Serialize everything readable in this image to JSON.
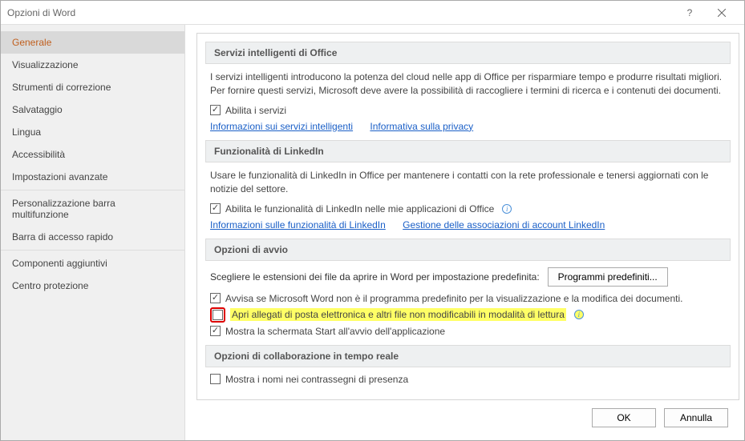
{
  "window": {
    "title": "Opzioni di Word"
  },
  "sidebar": {
    "items": [
      "Generale",
      "Visualizzazione",
      "Strumenti di correzione",
      "Salvataggio",
      "Lingua",
      "Accessibilità",
      "Impostazioni avanzate",
      "Personalizzazione barra multifunzione",
      "Barra di accesso rapido",
      "Componenti aggiuntivi",
      "Centro protezione"
    ]
  },
  "sections": {
    "smart": {
      "title": "Servizi intelligenti di Office",
      "desc": "I servizi intelligenti introducono la potenza del cloud nelle app di Office per risparmiare tempo e produrre risultati migliori. Per fornire questi servizi, Microsoft deve avere la possibilità di raccogliere i termini di ricerca e i contenuti dei documenti.",
      "check1": "Abilita i servizi",
      "link1": "Informazioni sui servizi intelligenti",
      "link2": "Informativa sulla privacy"
    },
    "linkedin": {
      "title": "Funzionalità di LinkedIn",
      "desc": "Usare le funzionalità di LinkedIn in Office per mantenere i contatti con la rete professionale e tenersi aggiornati con le notizie del settore.",
      "check1": "Abilita le funzionalità di LinkedIn nelle mie applicazioni di Office",
      "link1": "Informazioni sulle funzionalità di LinkedIn",
      "link2": "Gestione delle associazioni di account LinkedIn"
    },
    "startup": {
      "title": "Opzioni di avvio",
      "desc": "Scegliere le estensioni dei file da aprire in Word per impostazione predefinita:",
      "button": "Programmi predefiniti...",
      "check1": "Avvisa se Microsoft Word non è il programma predefinito per la visualizzazione e la modifica dei documenti.",
      "check2": "Apri allegati di posta elettronica e altri file non modificabili in modalità di lettura",
      "check3": "Mostra la schermata Start all'avvio dell'applicazione"
    },
    "collab": {
      "title": "Opzioni di collaborazione in tempo reale",
      "check1": "Mostra i nomi nei contrassegni di presenza"
    }
  },
  "footer": {
    "ok": "OK",
    "cancel": "Annulla"
  }
}
